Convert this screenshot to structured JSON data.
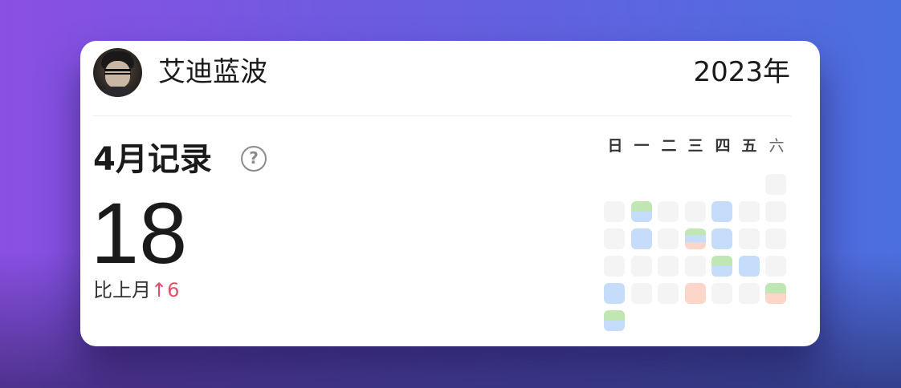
{
  "user": {
    "name": "艾迪蓝波",
    "avatar_icon": "user-avatar"
  },
  "year": "2023年",
  "summary": {
    "title": "4月记录",
    "help_icon": "question-circle-icon",
    "count": "18",
    "compare_label": "比上月",
    "compare_delta": "↑6",
    "delta_color": "#e0506a"
  },
  "calendar": {
    "weekdays": [
      "日",
      "一",
      "二",
      "三",
      "四",
      "五",
      "六"
    ],
    "colors": {
      "empty": "#f4f4f4",
      "green": "#bfe6b3",
      "blue": "#c5ddfa",
      "peach": "#fcd6c8"
    },
    "weeks": [
      [
        null,
        null,
        null,
        null,
        null,
        null,
        []
      ],
      [
        [],
        [
          "green",
          "blue"
        ],
        [],
        [],
        [
          "blue"
        ],
        [],
        []
      ],
      [
        [],
        [
          "blue"
        ],
        [],
        [
          "green",
          "blue",
          "peach"
        ],
        [
          "blue"
        ],
        [],
        []
      ],
      [
        [],
        [],
        [],
        [],
        [
          "green",
          "blue"
        ],
        [
          "blue"
        ],
        []
      ],
      [
        [
          "blue"
        ],
        [],
        [],
        [
          "peach"
        ],
        [],
        [],
        [
          "green",
          "peach"
        ]
      ],
      [
        [
          "green",
          "blue"
        ],
        null,
        null,
        null,
        null,
        null,
        null
      ]
    ]
  }
}
